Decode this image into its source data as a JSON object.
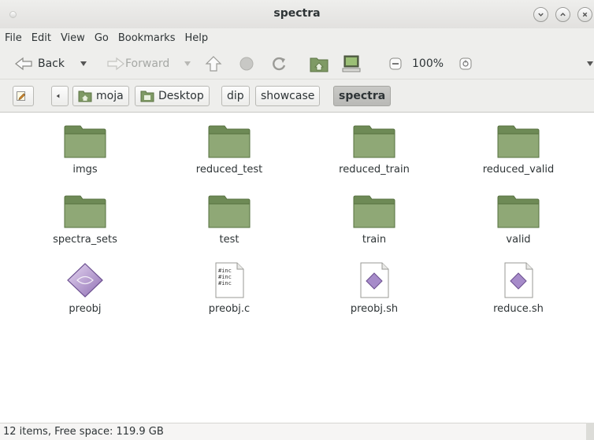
{
  "window": {
    "title": "spectra"
  },
  "menubar": [
    "File",
    "Edit",
    "View",
    "Go",
    "Bookmarks",
    "Help"
  ],
  "toolbar": {
    "back_label": "Back",
    "forward_label": "Forward",
    "zoom_label": "100%"
  },
  "pathbar": {
    "crumbs": [
      "moja",
      "Desktop",
      "dip",
      "showcase",
      "spectra"
    ],
    "active": "spectra"
  },
  "files": [
    {
      "name": "imgs",
      "icon": "folder-icon"
    },
    {
      "name": "reduced_test",
      "icon": "folder-icon"
    },
    {
      "name": "reduced_train",
      "icon": "folder-icon"
    },
    {
      "name": "reduced_valid",
      "icon": "folder-icon"
    },
    {
      "name": "spectra_sets",
      "icon": "folder-icon"
    },
    {
      "name": "test",
      "icon": "folder-icon"
    },
    {
      "name": "train",
      "icon": "folder-icon"
    },
    {
      "name": "valid",
      "icon": "folder-icon"
    },
    {
      "name": "preobj",
      "icon": "executable-icon"
    },
    {
      "name": "preobj.c",
      "icon": "c-source-icon",
      "preview": "#inc"
    },
    {
      "name": "preobj.sh",
      "icon": "script-icon"
    },
    {
      "name": "reduce.sh",
      "icon": "script-icon"
    }
  ],
  "status": {
    "text": "12 items, Free space: 119.9 GB"
  },
  "colors": {
    "folder": "#8fa876",
    "folder_dark": "#6e8a56",
    "active_crumb": "#c2c2bf"
  }
}
